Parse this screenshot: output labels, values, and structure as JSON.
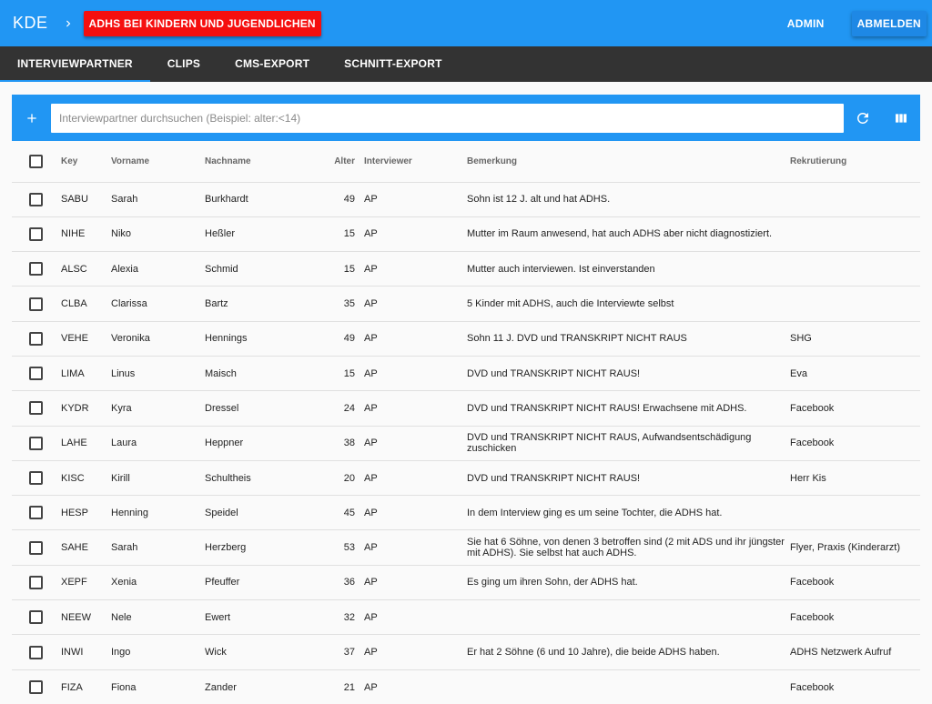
{
  "appbar": {
    "brand": "KDE",
    "project_label": "ADHS BEI KINDERN UND JUGENDLICHEN",
    "admin_label": "ADMIN",
    "logout_label": "ABMELDEN"
  },
  "tabs": [
    {
      "label": "INTERVIEWPARTNER",
      "active": true
    },
    {
      "label": "CLIPS",
      "active": false
    },
    {
      "label": "CMS-EXPORT",
      "active": false
    },
    {
      "label": "SCHNITT-EXPORT",
      "active": false
    }
  ],
  "toolbar": {
    "search_value": "",
    "search_placeholder": "Interviewpartner durchsuchen (Beispiel: alter:<14)",
    "icons": [
      "add-icon",
      "refresh-icon",
      "columns-icon"
    ]
  },
  "colors": {
    "primary": "#2196f3",
    "accent": "#f50f0f",
    "tabbar": "#333333"
  },
  "table": {
    "headers": {
      "key": "Key",
      "vorname": "Vorname",
      "nachname": "Nachname",
      "alter": "Alter",
      "interviewer": "Interviewer",
      "bemerkung": "Bemerkung",
      "rekrutierung": "Rekrutierung"
    },
    "rows": [
      {
        "key": "SABU",
        "vorname": "Sarah",
        "nachname": "Burkhardt",
        "alter": "49",
        "interviewer": "AP",
        "bemerkung": "Sohn ist 12 J. alt und hat ADHS.",
        "rekrutierung": ""
      },
      {
        "key": "NIHE",
        "vorname": "Niko",
        "nachname": "Heßler",
        "alter": "15",
        "interviewer": "AP",
        "bemerkung": "Mutter im Raum anwesend, hat auch ADHS aber nicht diagnostiziert.",
        "rekrutierung": ""
      },
      {
        "key": "ALSC",
        "vorname": "Alexia",
        "nachname": "Schmid",
        "alter": "15",
        "interviewer": "AP",
        "bemerkung": "Mutter auch interviewen. Ist einverstanden",
        "rekrutierung": ""
      },
      {
        "key": "CLBA",
        "vorname": "Clarissa",
        "nachname": "Bartz",
        "alter": "35",
        "interviewer": "AP",
        "bemerkung": "5 Kinder mit ADHS, auch die Interviewte selbst",
        "rekrutierung": ""
      },
      {
        "key": "VEHE",
        "vorname": "Veronika",
        "nachname": "Hennings",
        "alter": "49",
        "interviewer": "AP",
        "bemerkung": "Sohn 11 J. DVD und TRANSKRIPT NICHT RAUS",
        "rekrutierung": "SHG"
      },
      {
        "key": "LIMA",
        "vorname": "Linus",
        "nachname": "Maisch",
        "alter": "15",
        "interviewer": "AP",
        "bemerkung": "DVD und TRANSKRIPT NICHT RAUS!",
        "rekrutierung": "Eva"
      },
      {
        "key": "KYDR",
        "vorname": "Kyra",
        "nachname": "Dressel",
        "alter": "24",
        "interviewer": "AP",
        "bemerkung": "DVD und TRANSKRIPT NICHT RAUS! Erwachsene mit ADHS.",
        "rekrutierung": "Facebook"
      },
      {
        "key": "LAHE",
        "vorname": "Laura",
        "nachname": "Heppner",
        "alter": "38",
        "interviewer": "AP",
        "bemerkung": "DVD und TRANSKRIPT NICHT RAUS, Aufwandsentschädigung zuschicken",
        "rekrutierung": "Facebook"
      },
      {
        "key": "KISC",
        "vorname": "Kirill",
        "nachname": "Schultheis",
        "alter": "20",
        "interviewer": "AP",
        "bemerkung": "DVD und TRANSKRIPT NICHT RAUS!",
        "rekrutierung": "Herr Kis"
      },
      {
        "key": "HESP",
        "vorname": "Henning",
        "nachname": "Speidel",
        "alter": "45",
        "interviewer": "AP",
        "bemerkung": "In dem Interview ging es um seine Tochter, die ADHS hat.",
        "rekrutierung": ""
      },
      {
        "key": "SAHE",
        "vorname": "Sarah",
        "nachname": "Herzberg",
        "alter": "53",
        "interviewer": "AP",
        "bemerkung": "Sie hat 6 Söhne, von denen 3 betroffen sind (2 mit ADS und ihr jüngster mit ADHS). Sie selbst hat auch ADHS.",
        "rekrutierung": "Flyer, Praxis (Kinderarzt)"
      },
      {
        "key": "XEPF",
        "vorname": "Xenia",
        "nachname": "Pfeuffer",
        "alter": "36",
        "interviewer": "AP",
        "bemerkung": "Es ging um ihren Sohn, der ADHS hat.",
        "rekrutierung": "Facebook"
      },
      {
        "key": "NEEW",
        "vorname": "Nele",
        "nachname": "Ewert",
        "alter": "32",
        "interviewer": "AP",
        "bemerkung": "",
        "rekrutierung": "Facebook"
      },
      {
        "key": "INWI",
        "vorname": "Ingo",
        "nachname": "Wick",
        "alter": "37",
        "interviewer": "AP",
        "bemerkung": "Er hat 2 Söhne (6 und 10 Jahre), die beide ADHS haben.",
        "rekrutierung": "ADHS Netzwerk Aufruf"
      },
      {
        "key": "FIZA",
        "vorname": "Fiona",
        "nachname": "Zander",
        "alter": "21",
        "interviewer": "AP",
        "bemerkung": "",
        "rekrutierung": "Facebook"
      }
    ]
  }
}
